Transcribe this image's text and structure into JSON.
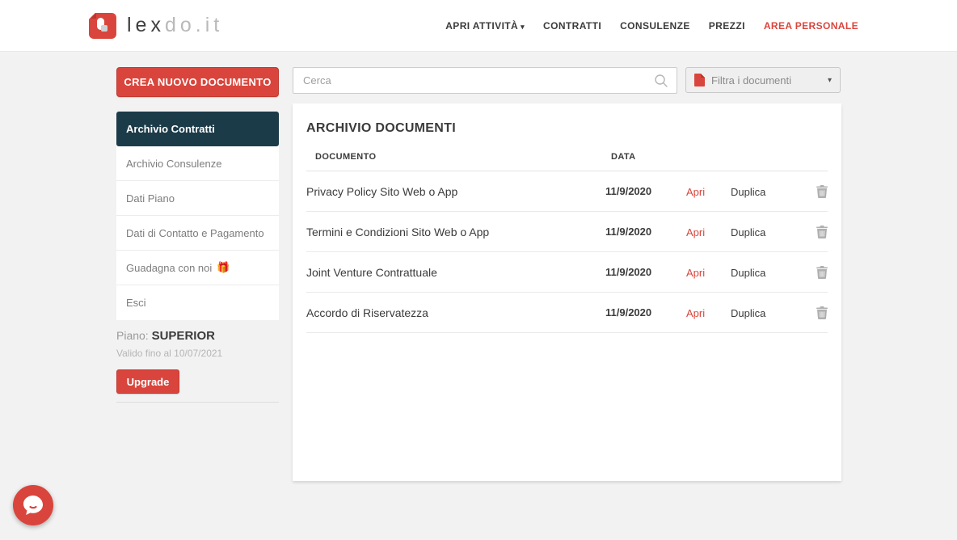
{
  "header": {
    "logo": {
      "text_dark": "lex",
      "text_light": "do.it"
    },
    "nav": {
      "items": [
        {
          "label": "APRI ATTIVITÀ"
        },
        {
          "label": "CONTRATTI"
        },
        {
          "label": "CONSULENZE"
        },
        {
          "label": "PREZZI"
        },
        {
          "label": "AREA PERSONALE"
        }
      ]
    }
  },
  "sidebar": {
    "create_button": "CREA NUOVO DOCUMENTO",
    "items": [
      {
        "label": "Archivio Contratti"
      },
      {
        "label": "Archivio Consulenze"
      },
      {
        "label": "Dati Piano"
      },
      {
        "label": "Dati di Contatto e Pagamento"
      },
      {
        "label": "Guadagna con noi",
        "emoji": "🎁"
      },
      {
        "label": "Esci"
      }
    ],
    "plan": {
      "label": "Piano: ",
      "name": "SUPERIOR",
      "validity": "Valido fino al 10/07/2021",
      "upgrade_button": "Upgrade"
    }
  },
  "search": {
    "placeholder": "Cerca"
  },
  "filter": {
    "label": "Filtra i documenti"
  },
  "archive": {
    "title": "ARCHIVIO DOCUMENTI",
    "columns": {
      "document": "DOCUMENTO",
      "date": "DATA"
    },
    "open_label": "Apri",
    "duplicate_label": "Duplica",
    "rows": [
      {
        "name": "Privacy Policy Sito Web o App",
        "date": "11/9/2020"
      },
      {
        "name": "Termini e Condizioni Sito Web o App",
        "date": "11/9/2020"
      },
      {
        "name": "Joint Venture Contrattuale",
        "date": "11/9/2020"
      },
      {
        "name": "Accordo di Riservatezza",
        "date": "11/9/2020"
      }
    ]
  },
  "icons": {
    "caret_down": "▾"
  },
  "colors": {
    "brand_red": "#d9453c",
    "active_item_bg": "#1c3b49",
    "text_dark": "#3b3b3b",
    "text_gray": "#8a8a8a",
    "page_bg": "#f2f2f2"
  }
}
